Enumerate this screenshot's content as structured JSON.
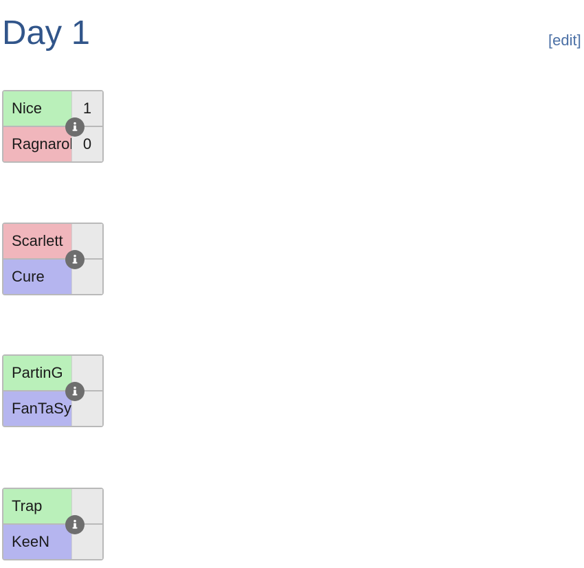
{
  "header": {
    "title": "Day 1",
    "edit_link": "[edit]"
  },
  "icons": {
    "info": "info-icon"
  },
  "colors": {
    "title": "#31558a",
    "link": "#4a6fa5",
    "win_green": "#baf0ba",
    "loss_red": "#f0b6bc",
    "neutral_purple": "#b5b5ef",
    "score_bg": "#e9e9e9",
    "border": "#b9b9b9",
    "badge": "#6e6e6e"
  },
  "bracket": {
    "matches": [
      {
        "top": {
          "name": "Nice",
          "score": "1",
          "result": "win"
        },
        "bottom": {
          "name": "Ragnarok",
          "score": "0",
          "result": "loss"
        }
      },
      {
        "top": {
          "name": "Scarlett",
          "score": "",
          "result": "loss"
        },
        "bottom": {
          "name": "Cure",
          "score": "",
          "result": "neutral"
        }
      },
      {
        "top": {
          "name": "PartinG",
          "score": "",
          "result": "win"
        },
        "bottom": {
          "name": "FanTaSy",
          "score": "",
          "result": "neutral"
        }
      },
      {
        "top": {
          "name": "Trap",
          "score": "",
          "result": "win"
        },
        "bottom": {
          "name": "KeeN",
          "score": "",
          "result": "neutral"
        }
      }
    ]
  }
}
